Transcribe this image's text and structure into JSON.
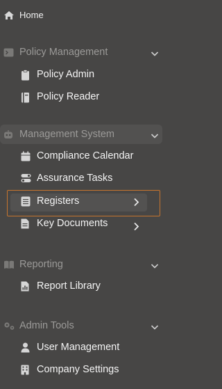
{
  "home": {
    "label": "Home",
    "icon": "home-icon"
  },
  "sections": [
    {
      "label": "Policy Management",
      "icon": "terminal-icon",
      "items": [
        {
          "label": "Policy Admin",
          "icon": "clipboard-icon"
        },
        {
          "label": "Policy Reader",
          "icon": "book-icon"
        }
      ]
    },
    {
      "label": "Management System",
      "icon": "robot-icon",
      "items": [
        {
          "label": "Compliance Calendar",
          "icon": "calendar-icon"
        },
        {
          "label": "Assurance Tasks",
          "icon": "toggles-icon"
        },
        {
          "label": "Registers",
          "icon": "register-icon"
        },
        {
          "label": "Key Documents",
          "icon": "document-icon"
        }
      ]
    },
    {
      "label": "Reporting",
      "icon": "open-book-icon",
      "items": [
        {
          "label": "Report Library",
          "icon": "report-icon"
        }
      ]
    },
    {
      "label": "Admin Tools",
      "icon": "gears-icon",
      "items": [
        {
          "label": "User Management",
          "icon": "user-icon"
        },
        {
          "label": "Company Settings",
          "icon": "building-icon"
        }
      ]
    }
  ],
  "colors": {
    "background": "#474645",
    "selection_outline": "#c7752e",
    "section_text": "#9b9a98"
  }
}
